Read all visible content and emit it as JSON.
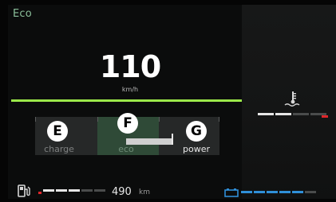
{
  "drive_mode": {
    "label": "Eco"
  },
  "speed": {
    "value": "110",
    "unit": "km/h"
  },
  "power_gauge": {
    "zones": [
      "charge",
      "eco",
      "power"
    ],
    "markers": [
      "E",
      "F",
      "G"
    ],
    "active_zone": "eco"
  },
  "fuel": {
    "icon": "fuel-pump-icon",
    "range_value": "490",
    "range_unit": "km",
    "segments_filled": 3,
    "segments_total": 6,
    "low_segment_color": "#e0262a"
  },
  "coolant": {
    "icon": "coolant-temperature-icon",
    "segments_filled": 2,
    "segments_total": 4,
    "high_segment_color": "#e0262a"
  },
  "battery": {
    "icon": "battery-icon",
    "segments_filled": 5,
    "segments_total": 6,
    "accent_color": "#2f8fd8"
  },
  "colors": {
    "accent_green": "#9be84a",
    "mode_label": "#8bbf9a",
    "eco_zone": "#2f4a37",
    "warning_red": "#e0262a",
    "battery_blue": "#2f8fd8"
  }
}
